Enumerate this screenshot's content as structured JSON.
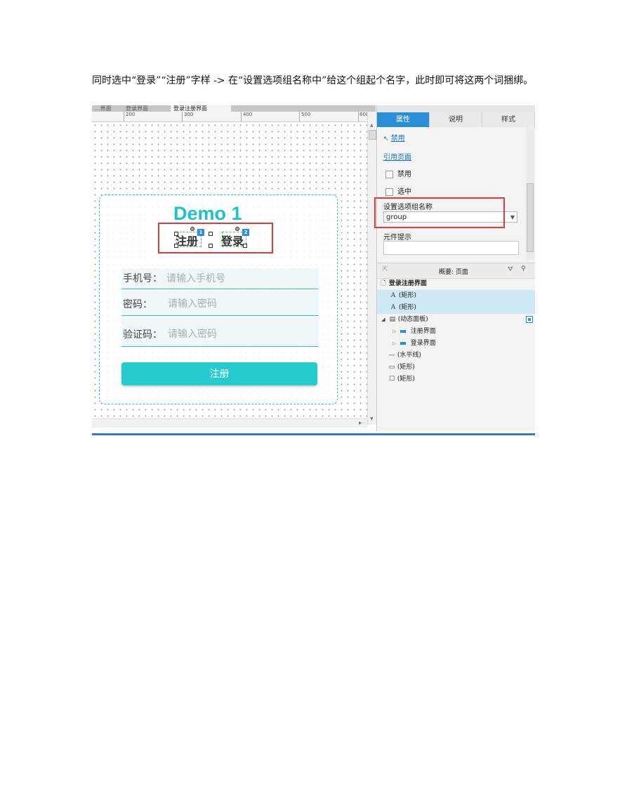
{
  "instruction": "同时选中“登录”“注册”字样 -> 在“设置选项组名称中”给这个组起个名字，此时即可将这两个词捆绑。",
  "editor": {
    "tabs": [
      "...界面",
      "登录界面",
      "登录注册界面"
    ],
    "ruler_labels": [
      "200",
      "300",
      "400",
      "500",
      "600"
    ]
  },
  "prototype": {
    "title": "Demo 1",
    "register_word": "注册",
    "login_word": "登录",
    "badge_1": "1",
    "badge_2": "2",
    "phone_label": "手机号：",
    "phone_placeholder": "请输入手机号",
    "password_label": "密码：",
    "password_placeholder": "请输入密码",
    "code_label": "验证码：",
    "code_placeholder": "请输入密码",
    "submit_label": "注册"
  },
  "inspector": {
    "tabs": [
      "属性",
      "说明",
      "样式"
    ],
    "active_tab": "属性",
    "disable_link": "禁用",
    "reference_page_link": "引用页面",
    "disabled_checkbox": "禁用",
    "selected_checkbox": "选中",
    "group_name_label": "设置选项组名称",
    "group_name_value": "group",
    "tooltip_label": "元件提示"
  },
  "outline": {
    "header": "概要: 页面",
    "rows": [
      {
        "label": "登录注册界面",
        "icon": "page-icon"
      },
      {
        "label": "(矩形)",
        "icon": "text-a-icon"
      },
      {
        "label": "(矩形)",
        "icon": "text-a-icon"
      },
      {
        "label": "(动态面板)",
        "icon": "dynamic-panel-icon"
      },
      {
        "label": "注册界面",
        "icon": "state-icon"
      },
      {
        "label": "登录界面",
        "icon": "state-icon"
      },
      {
        "label": "(水平线)",
        "icon": "line-icon"
      },
      {
        "label": "(矩形)",
        "icon": "rectangle-icon"
      },
      {
        "label": "(矩形)",
        "icon": "rectangle-icon"
      }
    ]
  },
  "colors": {
    "accent_teal": "#1fc2c9",
    "highlight_red": "#e03a3a",
    "tab_blue": "#2b8fd6"
  }
}
